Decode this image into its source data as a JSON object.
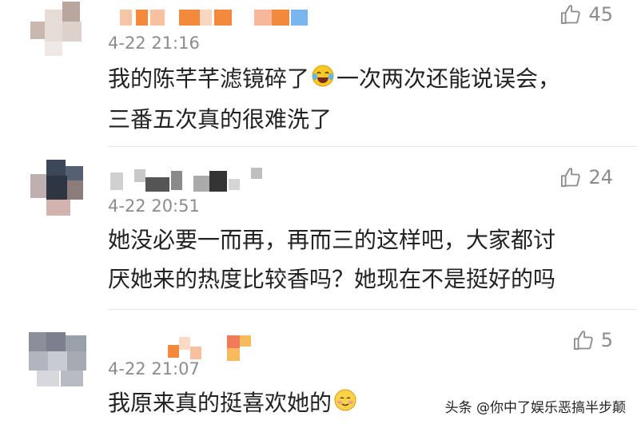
{
  "comments": [
    {
      "timestamp": "4-22 21:16",
      "like_count": "45",
      "lines": [
        "我的陈芊芊滤镜碎了",
        "一次两次还能说误会，",
        "三番五次真的很难洗了"
      ],
      "emoji": "laughing-crying"
    },
    {
      "timestamp": "4-22 20:51",
      "like_count": "24",
      "lines": [
        "她没必要一而再，再而三的这样吧，大家都讨",
        "厌她来的热度比较香吗？她现在不是挺好的吗"
      ]
    },
    {
      "timestamp": "4-22 21:07",
      "like_count": "5",
      "lines": [
        "我原来真的挺喜欢她的"
      ],
      "emoji": "smiling-blush"
    }
  ],
  "watermark": "头条 @你中了娱乐恶搞半步颠",
  "colors": {
    "text": "#222222",
    "meta": "#8c8c8c",
    "divider": "#e6e6e6",
    "blur_orange": "#f2893c",
    "blur_blue": "#79b6ef",
    "blur_gray": "#555555"
  }
}
